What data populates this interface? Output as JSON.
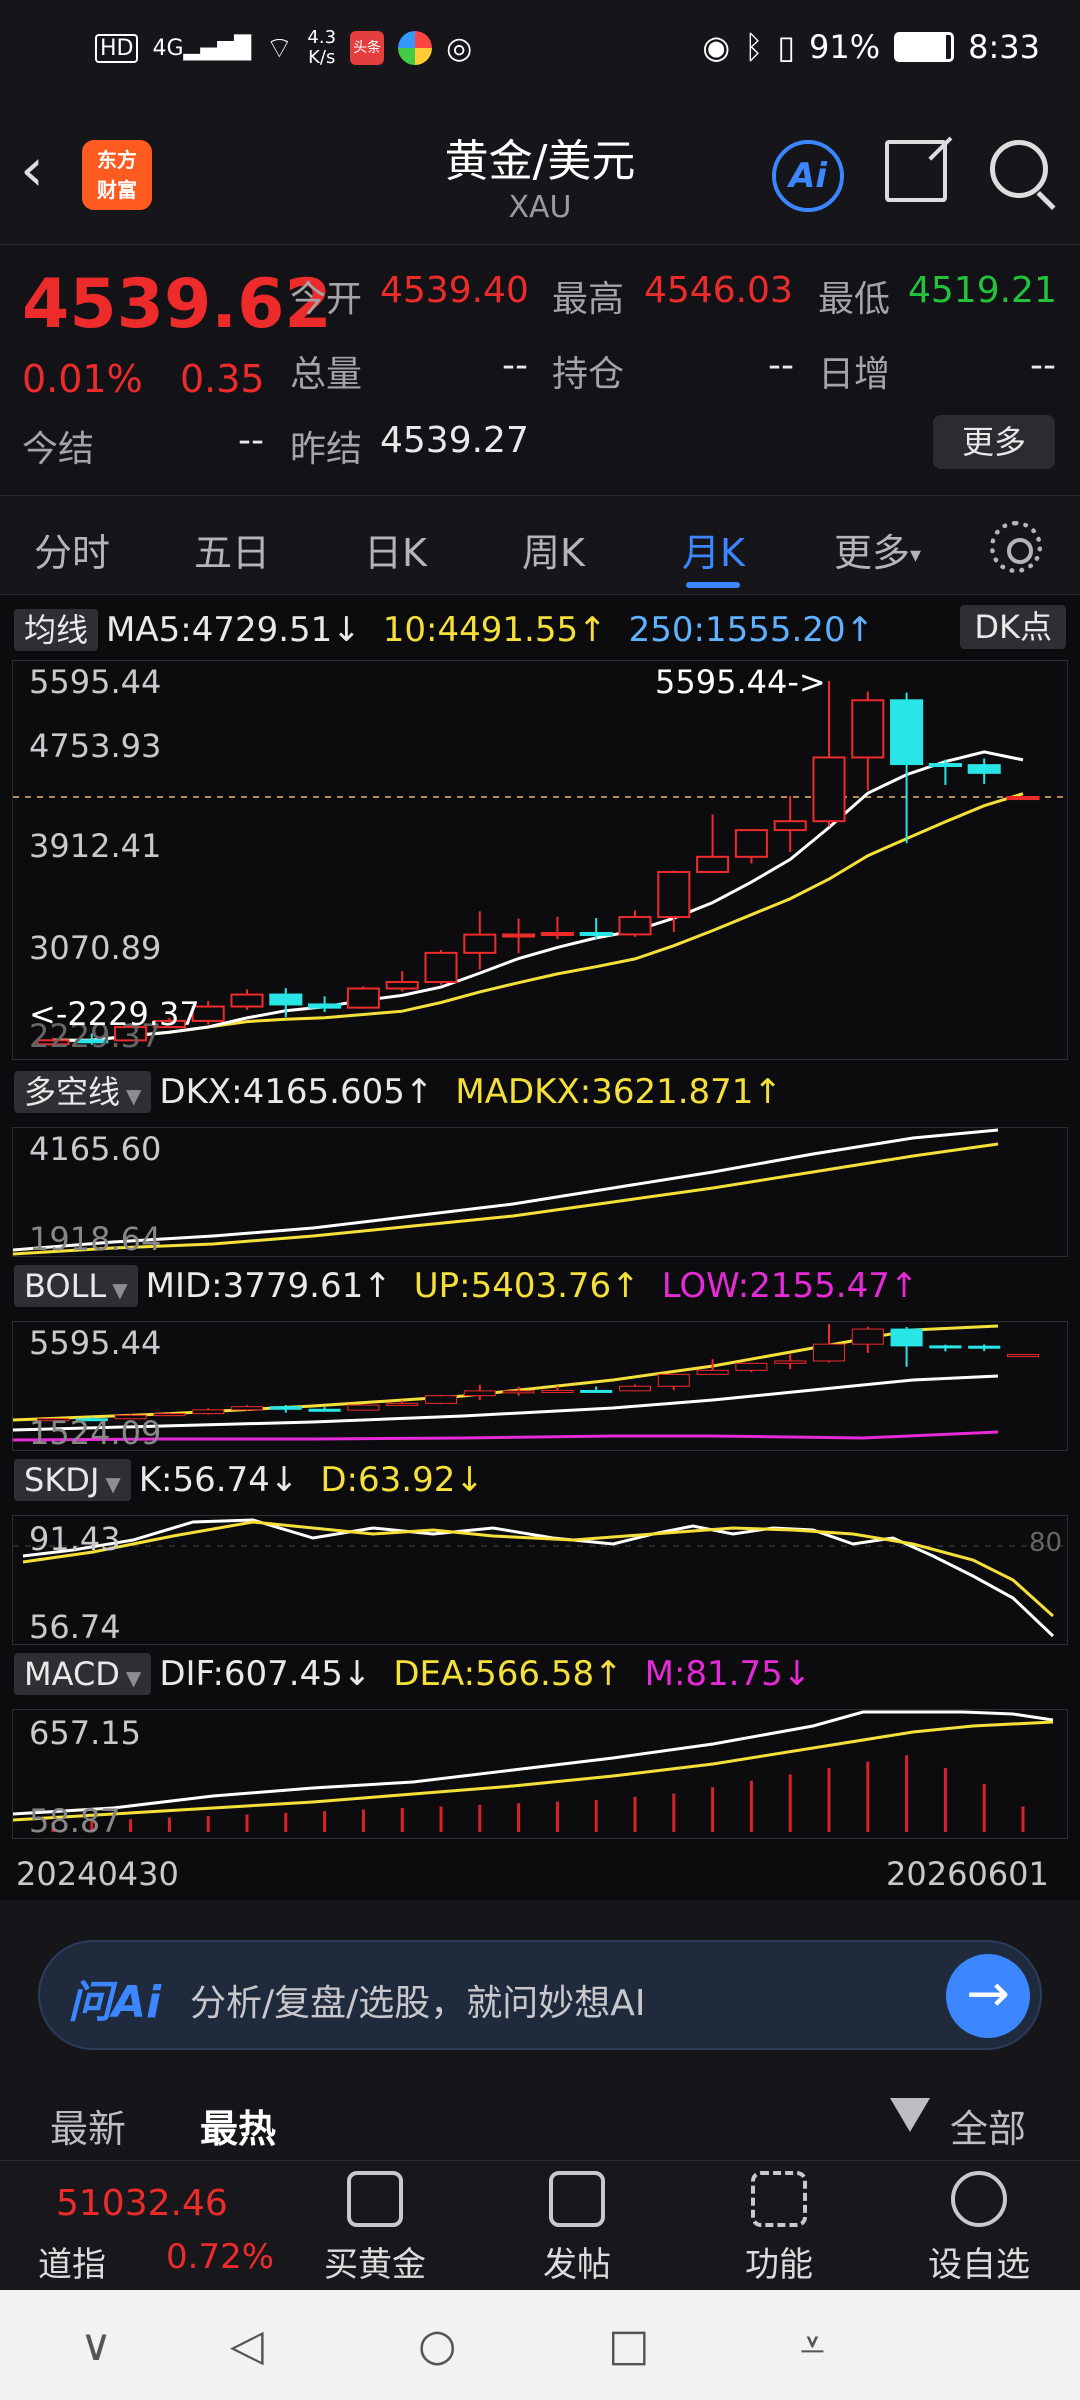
{
  "status_bar": {
    "hd": "HD",
    "net": "4G",
    "speed_value": "4.3",
    "speed_unit": "K/s",
    "battery": "91%",
    "time": "8:33",
    "app_icon_1": "头条"
  },
  "header": {
    "back_icon": "back-arrow-icon",
    "logo_line1": "东方",
    "logo_line2": "财富",
    "title": "黄金/美元",
    "subtitle": "XAU",
    "ai_label": "Ai"
  },
  "quote": {
    "price": "4539.62",
    "change_pct": "0.01%",
    "change": "0.35",
    "open_label": "今开",
    "open": "4539.40",
    "high_label": "最高",
    "high": "4546.03",
    "low_label": "最低",
    "low": "4519.21",
    "volume_label": "总量",
    "volume": "--",
    "position_label": "持仓",
    "position": "--",
    "daily_inc_label": "日增",
    "daily_inc": "--",
    "settle_label": "今结",
    "settle": "--",
    "prev_settle_label": "昨结",
    "prev_settle": "4539.27",
    "more_label": "更多"
  },
  "tabs": {
    "items": [
      "分时",
      "五日",
      "日K",
      "周K",
      "月K",
      "更多"
    ],
    "more_arrow": "▾",
    "active": "月K"
  },
  "indicators": {
    "ma": {
      "tag": "均线",
      "ma5": "MA5:4729.51",
      "ma5_arrow": "↓",
      "ma10": "10:4491.55",
      "ma10_arrow": "↑",
      "ma250": "250:1555.20",
      "ma250_arrow": "↑",
      "dk_label": "DK点"
    },
    "dkx": {
      "tag": "多空线",
      "dkx": "DKX:4165.605",
      "dkx_arrow": "↑",
      "madkx": "MADKX:3621.871",
      "madkx_arrow": "↑"
    },
    "boll": {
      "tag": "BOLL",
      "mid": "MID:3779.61",
      "mid_arrow": "↑",
      "up": "UP:5403.76",
      "up_arrow": "↑",
      "low": "LOW:2155.47",
      "low_arrow": "↑"
    },
    "skdj": {
      "tag": "SKDJ",
      "k": "K:56.74",
      "k_arrow": "↓",
      "d": "D:63.92",
      "d_arrow": "↓"
    },
    "macd": {
      "tag": "MACD",
      "dif": "DIF:607.45",
      "dif_arrow": "↓",
      "dea": "DEA:566.58",
      "dea_arrow": "↑",
      "m": "M:81.75",
      "m_arrow": "↓"
    }
  },
  "main_chart": {
    "y_labels": [
      "5595.44",
      "4753.93",
      "3912.41",
      "3070.89",
      "2229.37"
    ],
    "max_marker": "5595.44->",
    "min_marker": "<-2229.37"
  },
  "dkx_chart": {
    "y_labels": [
      "4165.60",
      "1918.64"
    ]
  },
  "boll_chart": {
    "y_labels": [
      "5595.44",
      "1524.09"
    ]
  },
  "skdj_chart": {
    "y_labels": [
      "91.43",
      "56.74"
    ],
    "ref_line": "80"
  },
  "macd_chart": {
    "y_labels": [
      "657.15",
      "58.87"
    ]
  },
  "dates": {
    "start": "20240430",
    "end": "20260601"
  },
  "chart_data": {
    "type": "candlestick",
    "period": "monthly",
    "ylim": [
      2229.37,
      5595.44
    ],
    "candles": [
      {
        "o": 2290,
        "c": 2327,
        "h": 2350,
        "l": 2277
      },
      {
        "o": 2327,
        "c": 2326,
        "h": 2388,
        "l": 2286
      },
      {
        "o": 2326,
        "c": 2447,
        "h": 2483,
        "l": 2353
      },
      {
        "o": 2447,
        "c": 2503,
        "h": 2531,
        "l": 2471
      },
      {
        "o": 2503,
        "c": 2634,
        "h": 2685,
        "l": 2471
      },
      {
        "o": 2634,
        "c": 2743,
        "h": 2790,
        "l": 2603
      },
      {
        "o": 2743,
        "c": 2653,
        "h": 2801,
        "l": 2537
      },
      {
        "o": 2653,
        "c": 2624,
        "h": 2726,
        "l": 2583
      },
      {
        "o": 2624,
        "c": 2798,
        "h": 2817,
        "l": 2614
      },
      {
        "o": 2798,
        "c": 2857,
        "h": 2956,
        "l": 2772
      },
      {
        "o": 2857,
        "c": 3122,
        "h": 3148,
        "l": 2832
      },
      {
        "o": 3122,
        "c": 3288,
        "h": 3500,
        "l": 2970
      },
      {
        "o": 3288,
        "c": 3289,
        "h": 3435,
        "l": 3120
      },
      {
        "o": 3289,
        "c": 3303,
        "h": 3451,
        "l": 3247
      },
      {
        "o": 3303,
        "c": 3290,
        "h": 3439,
        "l": 3248
      },
      {
        "o": 3290,
        "c": 3448,
        "h": 3509,
        "l": 3268
      },
      {
        "o": 3448,
        "c": 3858,
        "h": 3872,
        "l": 3311
      },
      {
        "o": 3858,
        "c": 3996,
        "h": 4381,
        "l": 3885
      },
      {
        "o": 3996,
        "c": 4239,
        "h": 4245,
        "l": 3935
      },
      {
        "o": 4239,
        "c": 4320,
        "h": 4550,
        "l": 4040
      },
      {
        "o": 4320,
        "c": 4900,
        "h": 5595.44,
        "l": 4272
      },
      {
        "o": 4900,
        "c": 5420,
        "h": 5500,
        "l": 4600
      },
      {
        "o": 5420,
        "c": 4840,
        "h": 5490,
        "l": 4120
      },
      {
        "o": 4840,
        "c": 4830,
        "h": 4880,
        "l": 4650
      },
      {
        "o": 4830,
        "c": 4760,
        "h": 4890,
        "l": 4660
      },
      {
        "o": 4539.4,
        "c": 4539.62,
        "h": 4546.03,
        "l": 4519.21
      }
    ]
  },
  "ask_ai": {
    "logo": "问Ai",
    "placeholder": "分析/复盘/选股，就问妙想AI",
    "go_icon": "→"
  },
  "news_tabs": {
    "items": [
      "最新",
      "最热"
    ],
    "filter_label": "全部"
  },
  "bottom_bar": {
    "index_value": "51032.46",
    "index_name": "道指",
    "index_pct": "0.72%",
    "items": [
      "买黄金",
      "发帖",
      "功能",
      "设自选"
    ]
  },
  "system_nav": {
    "hide_icon": "∨",
    "back_icon": "◁",
    "home_icon": "○",
    "recent_icon": "□",
    "menu_icon": "⩡"
  }
}
